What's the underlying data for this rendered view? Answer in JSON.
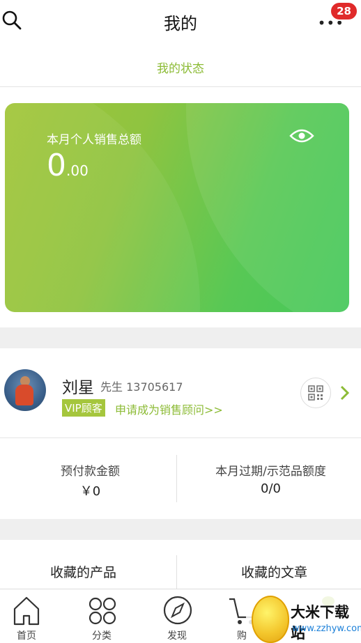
{
  "header": {
    "title": "我的",
    "badge_count": "28"
  },
  "status_tab": {
    "label": "我的状态"
  },
  "sales_card": {
    "label": "本月个人销售总额",
    "amount_int": "0",
    "amount_dec": ".00"
  },
  "profile": {
    "name": "刘星",
    "title_phone": "先生 13705617",
    "vip_badge": "VIP顾客",
    "apply_link": "申请成为销售顾问>>"
  },
  "stats": [
    {
      "label": "预付款金额",
      "value": "￥0"
    },
    {
      "label": "本月过期/示范品额度",
      "value": "0/0"
    }
  ],
  "favorites": [
    {
      "label": "收藏的产品"
    },
    {
      "label": "收藏的文章"
    }
  ],
  "tabbar": [
    {
      "label": "首页",
      "icon": "home-icon"
    },
    {
      "label": "分类",
      "icon": "category-icon"
    },
    {
      "label": "发现",
      "icon": "compass-icon"
    },
    {
      "label": "购",
      "icon": "cart-icon"
    }
  ],
  "watermark": {
    "brand": "大米下载站",
    "url": "www.zzhyw.com"
  },
  "colors": {
    "accent": "#8cbb35",
    "card_start": "#a3c63a",
    "card_end": "#44c85a",
    "badge": "#e02a2a"
  }
}
